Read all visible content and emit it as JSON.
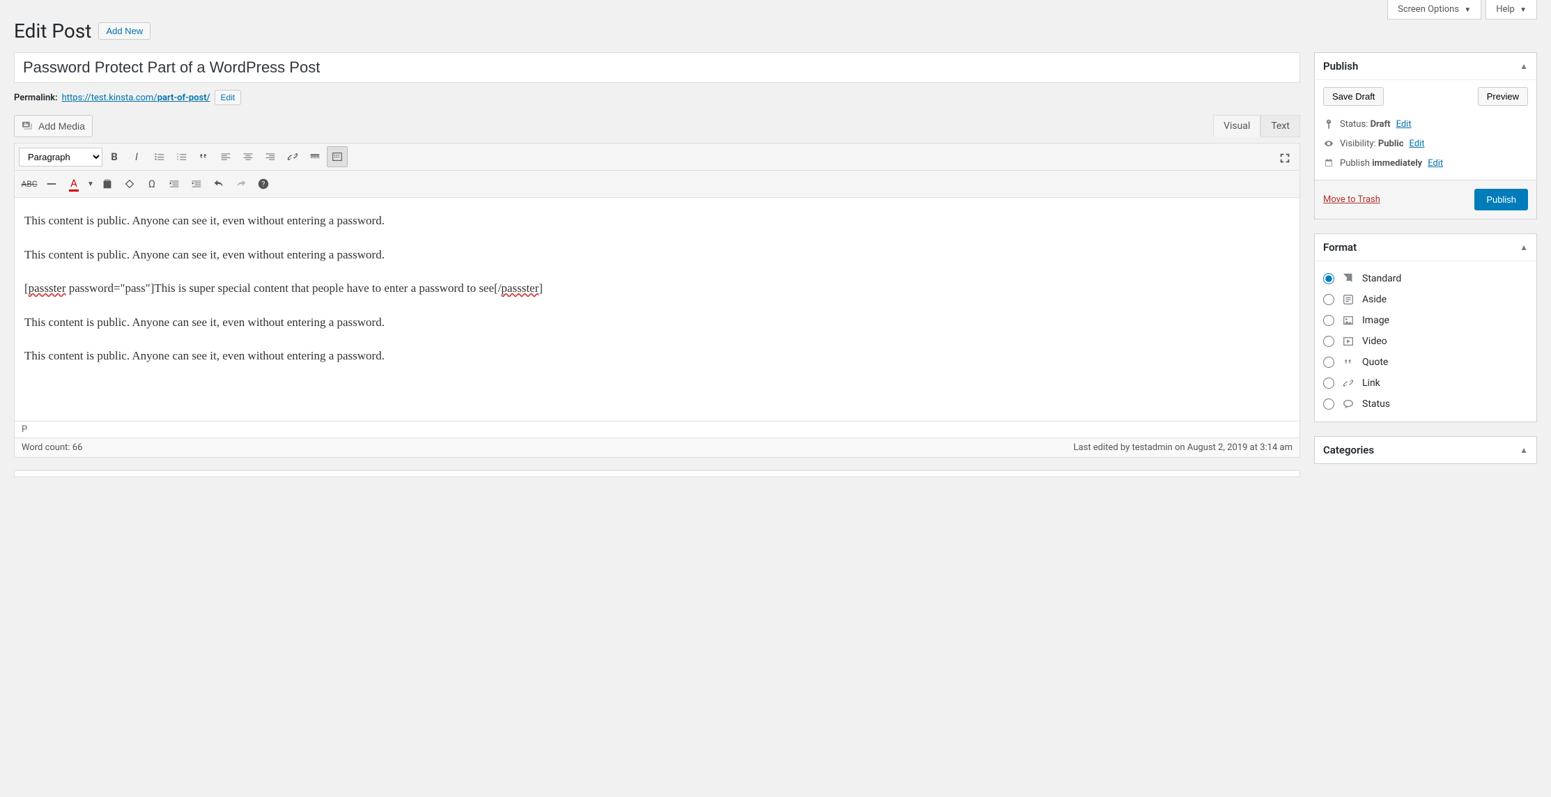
{
  "topTabs": {
    "screenOptions": "Screen Options",
    "help": "Help"
  },
  "header": {
    "title": "Edit Post",
    "addNew": "Add New"
  },
  "post": {
    "title": "Password Protect Part of a WordPress Post",
    "permalinkLabel": "Permalink:",
    "permalinkBase": "https://test.kinsta.com/",
    "permalinkSlug": "part-of-post/",
    "editBtn": "Edit"
  },
  "editor": {
    "addMedia": "Add Media",
    "tabs": {
      "visual": "Visual",
      "text": "Text"
    },
    "formatSelect": "Paragraph",
    "content": {
      "p1": "This content is public. Anyone can see it, even without entering a password.",
      "p2": "This content is public. Anyone can see it, even without entering a password.",
      "p3a": "[",
      "p3b": "passster",
      "p3c": " password=\"pass\"]This is super special content that people have to enter a password to see[/",
      "p3d": "passster",
      "p3e": "]",
      "p4": "This content is public. Anyone can see it, even without entering a password.",
      "p5": "This content is public. Anyone can see it, even without entering a password."
    },
    "path": "P",
    "wordCount": "Word count: 66",
    "lastEdited": "Last edited by testadmin on August 2, 2019 at 3:14 am"
  },
  "publish": {
    "title": "Publish",
    "saveDraft": "Save Draft",
    "preview": "Preview",
    "statusLabel": "Status:",
    "statusValue": "Draft",
    "visibilityLabel": "Visibility:",
    "visibilityValue": "Public",
    "publishLabel": "Publish",
    "publishValue": "immediately",
    "edit": "Edit",
    "trash": "Move to Trash",
    "publishBtn": "Publish"
  },
  "format": {
    "title": "Format",
    "items": [
      {
        "label": "Standard",
        "checked": true
      },
      {
        "label": "Aside",
        "checked": false
      },
      {
        "label": "Image",
        "checked": false
      },
      {
        "label": "Video",
        "checked": false
      },
      {
        "label": "Quote",
        "checked": false
      },
      {
        "label": "Link",
        "checked": false
      },
      {
        "label": "Status",
        "checked": false
      }
    ]
  },
  "categories": {
    "title": "Categories"
  }
}
